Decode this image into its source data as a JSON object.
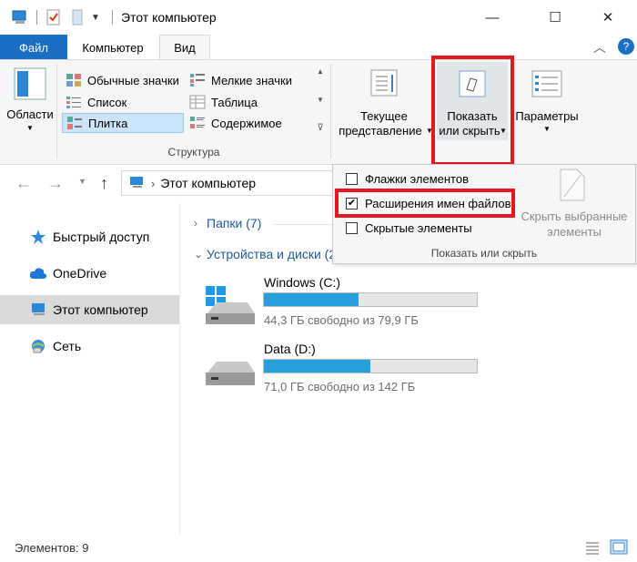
{
  "window": {
    "title": "Этот компьютер",
    "minimize_glyph": "—",
    "maximize_glyph": "☐",
    "close_glyph": "✕"
  },
  "ribbon_tabs": {
    "file": "Файл",
    "computer": "Компьютер",
    "view": "Вид",
    "collapse_glyph": "︿",
    "help_glyph": "?"
  },
  "ribbon": {
    "panes": {
      "navigation_pane": "Области"
    },
    "layout": {
      "group_label": "Структура",
      "items": [
        "Обычные значки",
        "Мелкие значки",
        "Список",
        "Таблица",
        "Плитка",
        "Содержимое"
      ],
      "selected": "Плитка"
    },
    "current_view": {
      "line1": "Текущее",
      "line2": "представление"
    },
    "show_hide": {
      "line1": "Показать",
      "line2": "или скрыть"
    },
    "options": "Параметры"
  },
  "dropdown": {
    "item_checkboxes": "Флажки элементов",
    "file_extensions": "Расширения имен файлов",
    "hidden_items": "Скрытые элементы",
    "hide_selected_line1": "Скрыть выбранные",
    "hide_selected_line2": "элементы",
    "group_label": "Показать или скрыть",
    "states": {
      "item_checkboxes": false,
      "file_extensions": true,
      "hidden_items": false
    }
  },
  "address": {
    "path": "Этот компьютер"
  },
  "sidebar": {
    "items": [
      {
        "label": "Быстрый доступ",
        "icon": "star-icon"
      },
      {
        "label": "OneDrive",
        "icon": "cloud-icon"
      },
      {
        "label": "Этот компьютер",
        "icon": "computer-icon",
        "selected": true
      },
      {
        "label": "Сеть",
        "icon": "network-icon"
      }
    ]
  },
  "content": {
    "folders_header": "Папки (7)",
    "devices_header": "Устройства и диски (2)",
    "drives": [
      {
        "name": "Windows (C:)",
        "free_text": "44,3 ГБ свободно из 79,9 ГБ",
        "used_fraction": 0.445
      },
      {
        "name": "Data (D:)",
        "free_text": "71,0 ГБ свободно из 142 ГБ",
        "used_fraction": 0.5
      }
    ]
  },
  "status_bar": {
    "items_count": "Элементов: 9"
  },
  "colors": {
    "accent": "#1a6fc4",
    "highlight": "#e3171d",
    "drive_fill": "#26a0da"
  }
}
